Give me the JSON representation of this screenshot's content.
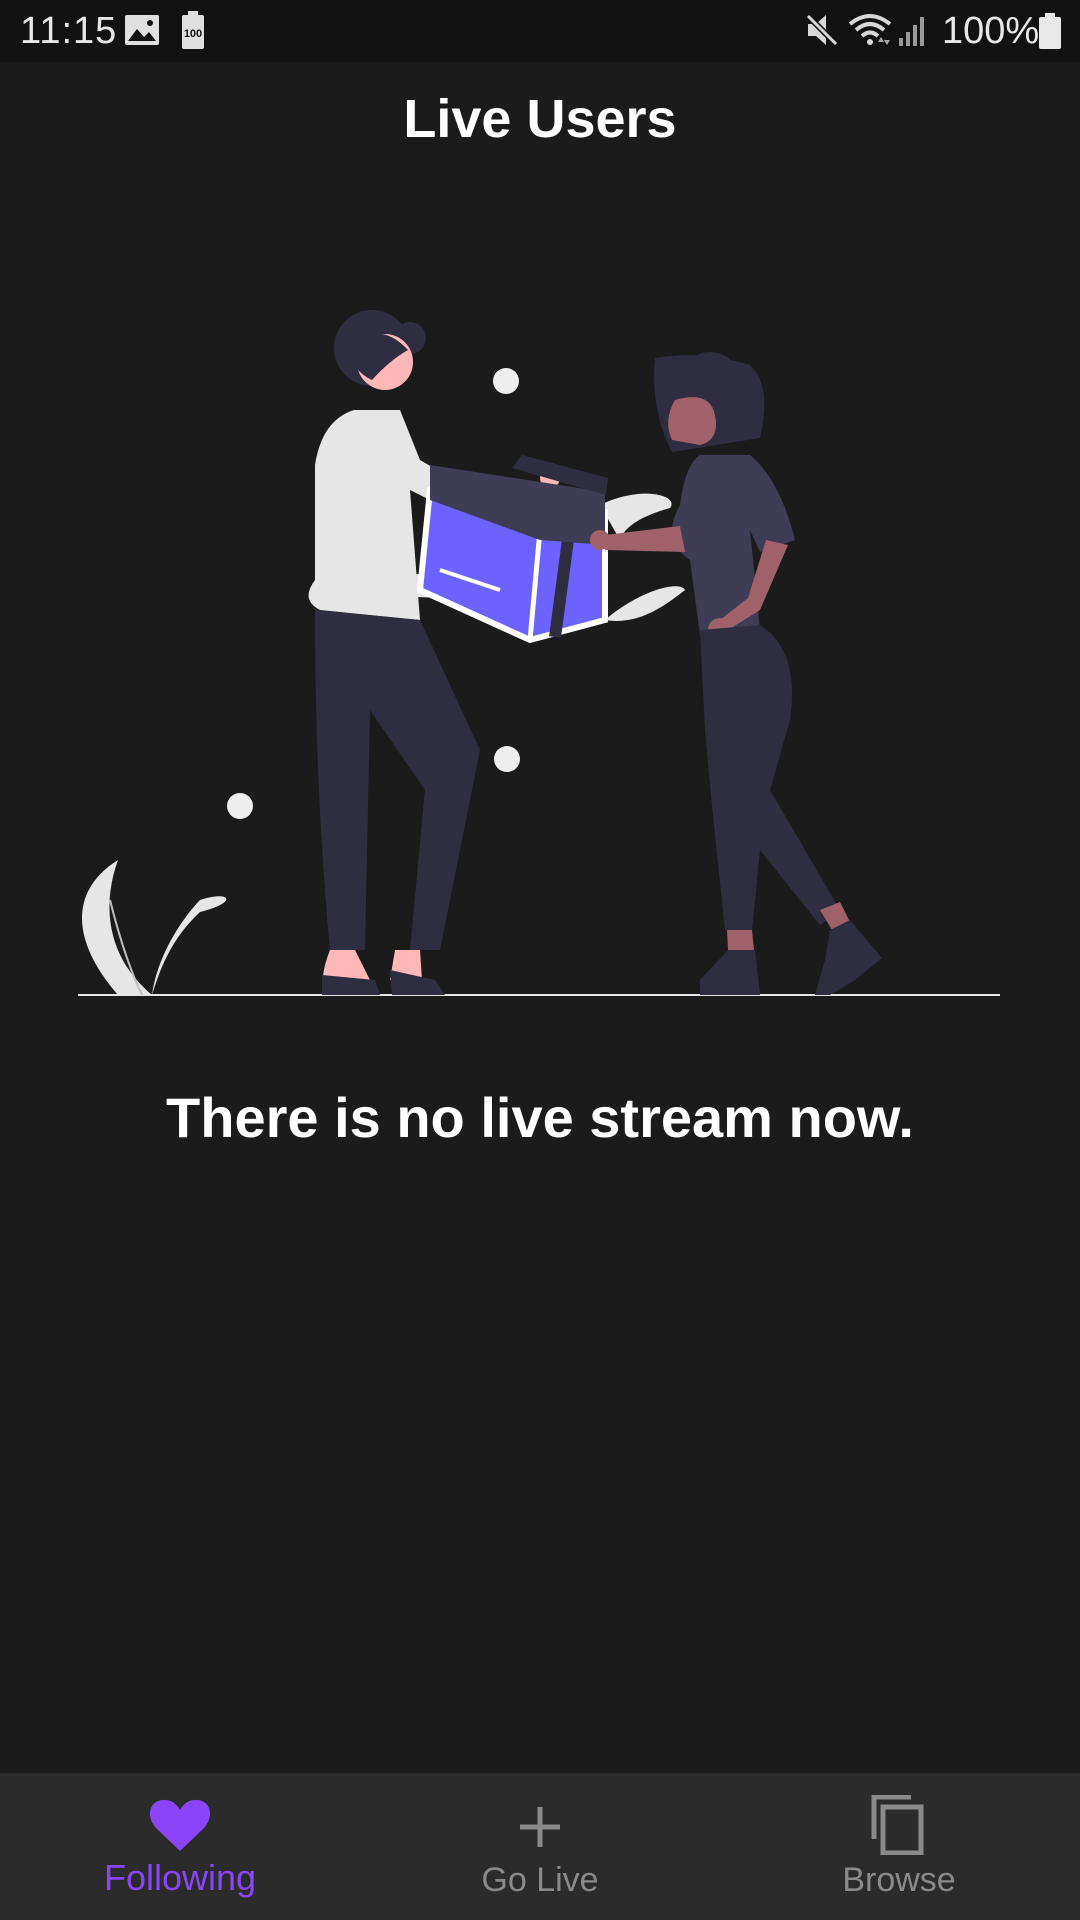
{
  "status_bar": {
    "time": "11:15",
    "battery_percent": "100%",
    "icons": [
      "image-icon",
      "battery-saver-icon",
      "mute-icon",
      "wifi-icon",
      "signal-icon",
      "battery-icon"
    ]
  },
  "header": {
    "title": "Live Users"
  },
  "main": {
    "empty_message": "There is no live stream now.",
    "illustration": "gift-handover-illustration"
  },
  "bottom_nav": {
    "items": [
      {
        "label": "Following",
        "icon": "heart-icon",
        "active": true
      },
      {
        "label": "Go Live",
        "icon": "plus-icon",
        "active": false
      },
      {
        "label": "Browse",
        "icon": "copy-icon",
        "active": false
      }
    ]
  },
  "colors": {
    "background": "#1b1b1b",
    "accent": "#8b44f7",
    "nav_background": "#2b2b2b",
    "inactive": "#8a8a8a"
  }
}
